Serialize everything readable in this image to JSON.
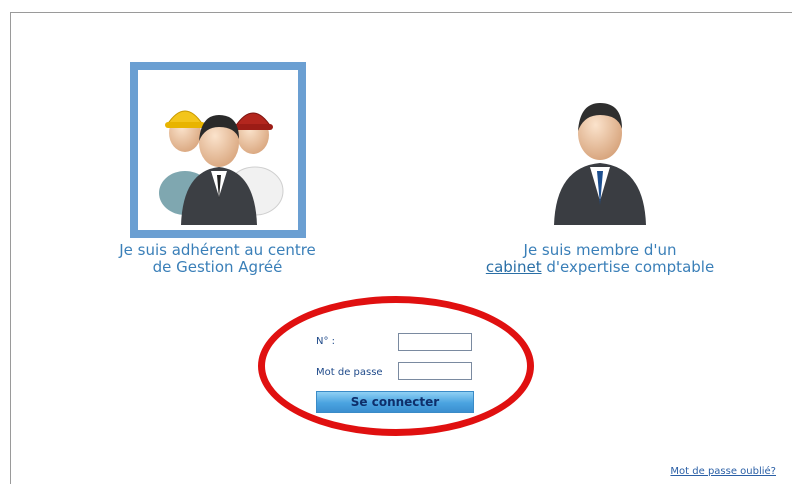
{
  "choices": {
    "adherent": {
      "label": "Je suis adhérent au centre de Gestion Agréé",
      "icon": "group-of-workers-icon"
    },
    "cabinet": {
      "label_before": "Je suis membre d'un",
      "label_link": "cabinet",
      "label_after": "d'expertise comptable",
      "icon": "business-person-icon"
    }
  },
  "login": {
    "number_label": "N° :",
    "number_value": "",
    "password_label": "Mot de passe",
    "password_value": "",
    "submit_label": "Se connecter"
  },
  "footer": {
    "forgot_password": "Mot de passe oublié?"
  },
  "colors": {
    "tile_border": "#6b9fd2",
    "label_text": "#3a7fb8",
    "highlight": "#e01010",
    "button": "#4aa3e0"
  }
}
